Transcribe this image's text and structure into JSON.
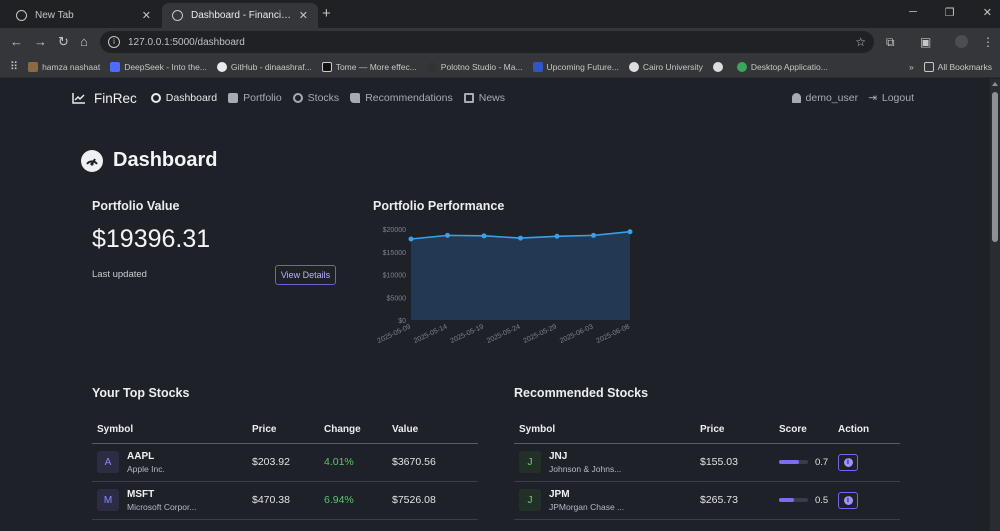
{
  "browser": {
    "tabs": [
      {
        "title": "New Tab"
      },
      {
        "title": "Dashboard - Financial Investme..."
      }
    ],
    "url": "127.0.0.1:5000/dashboard",
    "bookmarks": [
      "hamza nashaat",
      "DeepSeek - Into the...",
      "GitHub - dinaashraf...",
      "Tome — More effec...",
      "Polotno Studio - Ma...",
      "Upcoming Future...",
      "Cairo University",
      "",
      "Desktop Applicatio..."
    ],
    "all_bookmarks": "All Bookmarks"
  },
  "app": {
    "brand": "FinRec",
    "nav": [
      {
        "label": "Dashboard",
        "icon": "gauge-icon"
      },
      {
        "label": "Portfolio",
        "icon": "briefcase-icon"
      },
      {
        "label": "Stocks",
        "icon": "search-icon"
      },
      {
        "label": "Recommendations",
        "icon": "thumbs-up-icon"
      },
      {
        "label": "News",
        "icon": "newspaper-icon"
      }
    ],
    "user": "demo_user",
    "logout": "Logout"
  },
  "page": {
    "title": "Dashboard",
    "portfolio_value": {
      "title": "Portfolio Value",
      "value": "$19396.31",
      "last_updated": "Last updated",
      "button": "View Details"
    },
    "performance_title": "Portfolio Performance",
    "top_stocks": {
      "title": "Your Top Stocks",
      "headers": [
        "Symbol",
        "Price",
        "Change",
        "Value"
      ],
      "rows": [
        {
          "symbol": "AAPL",
          "name": "Apple Inc.",
          "letter": "A",
          "price": "$203.92",
          "change": "4.01%",
          "value": "$3670.56"
        },
        {
          "symbol": "MSFT",
          "name": "Microsoft Corpor...",
          "letter": "M",
          "price": "$470.38",
          "change": "6.94%",
          "value": "$7526.08"
        }
      ]
    },
    "recommended": {
      "title": "Recommended Stocks",
      "headers": [
        "Symbol",
        "Price",
        "Score",
        "Action"
      ],
      "rows": [
        {
          "symbol": "JNJ",
          "name": "Johnson & Johns...",
          "letter": "J",
          "price": "$155.03",
          "score": "0.7",
          "score_value": 0.7
        },
        {
          "symbol": "JPM",
          "name": "JPMorgan Chase ...",
          "letter": "J",
          "price": "$265.73",
          "score": "0.5",
          "score_value": 0.5
        }
      ]
    }
  },
  "chart_data": {
    "type": "area",
    "x": [
      "2025-05-09",
      "2025-05-14",
      "2025-05-19",
      "2025-05-24",
      "2025-05-29",
      "2025-06-03",
      "2025-06-08"
    ],
    "values": [
      17800,
      18600,
      18500,
      18000,
      18400,
      18600,
      19400
    ],
    "ylim": [
      0,
      20000
    ],
    "yticks": [
      "$0",
      "$5000",
      "$10000",
      "$15000",
      "$20000"
    ],
    "colors": {
      "line": "#36a2eb",
      "fill": "#243a55"
    }
  }
}
